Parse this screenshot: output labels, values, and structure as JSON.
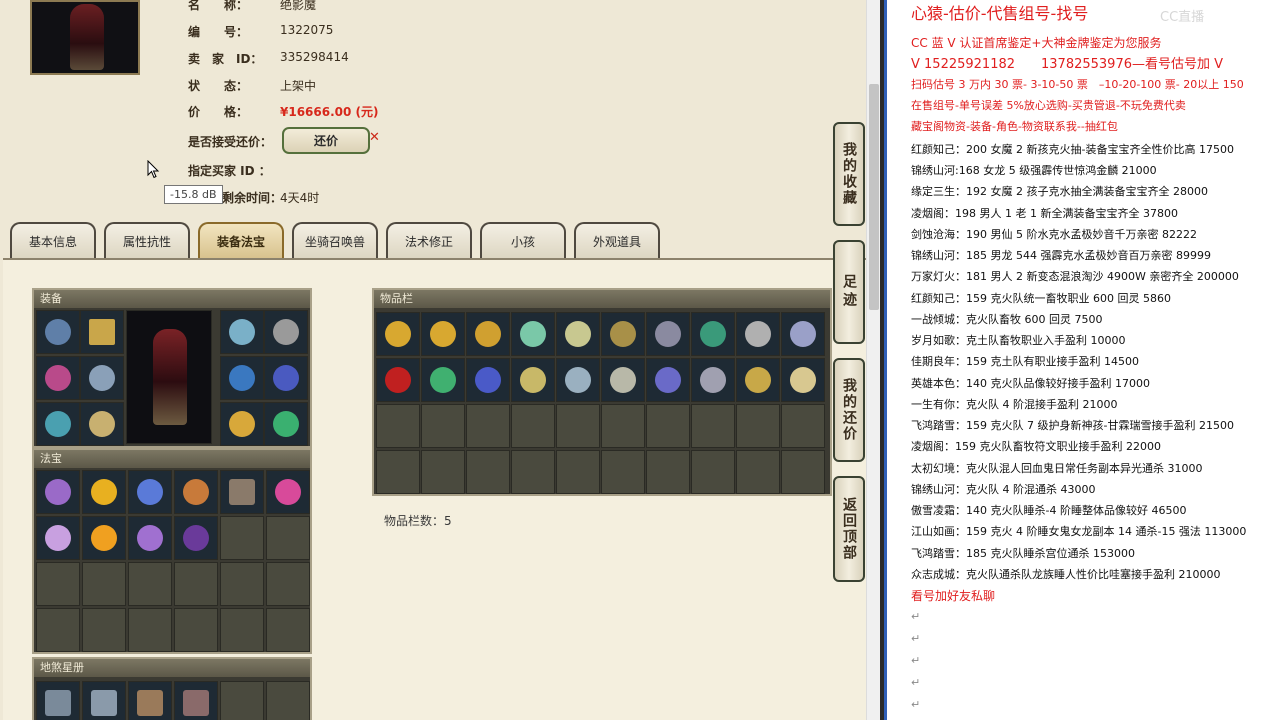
{
  "top_info": {
    "rows": [
      {
        "label": "名　　称：",
        "value": "绝影魔"
      },
      {
        "label": "编　　号：",
        "value": "1322075"
      },
      {
        "label": "卖　家　ID：",
        "value": "335298414"
      },
      {
        "label": "状　　态：",
        "value": "上架中"
      },
      {
        "label": "价　　格：",
        "value": "¥16666.00 (元)"
      }
    ],
    "counter_offer_label": "是否接受还价：",
    "counter_offer_button": "还价",
    "buyer_id_label": "指定买家 ID ：",
    "time_left_label": "剩余时间：",
    "time_left_value": "4天4时",
    "tooltip": "-15.8 dB"
  },
  "tabs": [
    "基本信息",
    "属性抗性",
    "装备法宝",
    "坐骑召唤兽",
    "法术修正",
    "小孩",
    "外观道具"
  ],
  "active_tab": "装备法宝",
  "equip_panel": {
    "title": "装备"
  },
  "fabao_panel": {
    "title": "法宝"
  },
  "star_panel": {
    "title": "地煞星册"
  },
  "inventory_panel": {
    "title": "物品栏",
    "count_label": "物品栏数：5"
  },
  "side_buttons": [
    "我的收藏",
    "足迹",
    "我的还价",
    "返回顶部"
  ],
  "notes": {
    "header": "心猿-估价-代售组号-找号",
    "line1": "CC 蓝 V 认证首席鉴定+大神金牌鉴定为您服务",
    "line2": "V 15225921182　　13782553976—看号估号加 V",
    "line3": "扫码估号 3 万内 30 票- 3-10-50 票　–10-20-100 票- 20以上 150",
    "line4": "在售组号-单号误差 5%放心选购-买贵管退-不玩免费代卖",
    "line5": "藏宝阁物资-装备-角色-物资联系我--抽红包",
    "listings": [
      "红颜知己：200 女魔 2 新孩克火抽-装备宝宝齐全性价比高 17500",
      "锦绣山河:168 女龙 5 级强霹传世惊鸿金麟 21000",
      "缘定三生：192 女魔 2 孩子克水抽全满装备宝宝齐全 28000",
      "凌烟阁：198 男人 1 老 1 新全满装备宝宝齐全 37800",
      "剑蚀沧海：190 男仙 5 阶水克水孟极妙音千万亲密 82222",
      "锦绣山河：185 男龙 544 强霹克水孟极妙音百万亲密 89999",
      "万家灯火：181 男人 2 新变态混浪淘沙 4900W 亲密齐全 200000",
      "红颜知己：159 克火队统一畜牧职业 600 回灵 5860",
      "一战倾城：克火队畜牧 600 回灵 7500",
      "岁月如歌：克土队畜牧职业入手盈利 10000",
      "佳期良年：159 克土队有职业接手盈利 14500",
      "英雄本色：140 克火队品像较好接手盈利 17000",
      "一生有你：克火队 4 阶混接手盈利 21000",
      "飞鸿踏雪：159 克火队 7 级护身新神孩-甘霖瑞雪接手盈利 21500",
      "凌烟阁：159 克火队畜牧符文职业接手盈利 22000",
      "太初幻境：克火队混人回血鬼日常任务副本异光通杀 31000",
      "锦绣山河：克火队 4 阶混通杀 43000",
      "傲雪凌霜：140 克火队睡杀-4 阶睡整体品像较好 46500",
      "江山如画：159 克火 4 阶睡女鬼女龙副本 14 通杀-15 强法 113000",
      "飞鸿踏雪：185 克火队睡杀宫位通杀 153000",
      "众志成城：克火队通杀队龙族睡人性价比哇塞接手盈利 210000"
    ],
    "footer": "看号加好友私聊",
    "return_mark": "↵",
    "watermark": "CC直播"
  },
  "colors": {
    "accent_red": "#e01e1e",
    "price_red": "#d7281b",
    "panel_bg": "#eee8d6",
    "right_border": "#2f5fb8"
  }
}
